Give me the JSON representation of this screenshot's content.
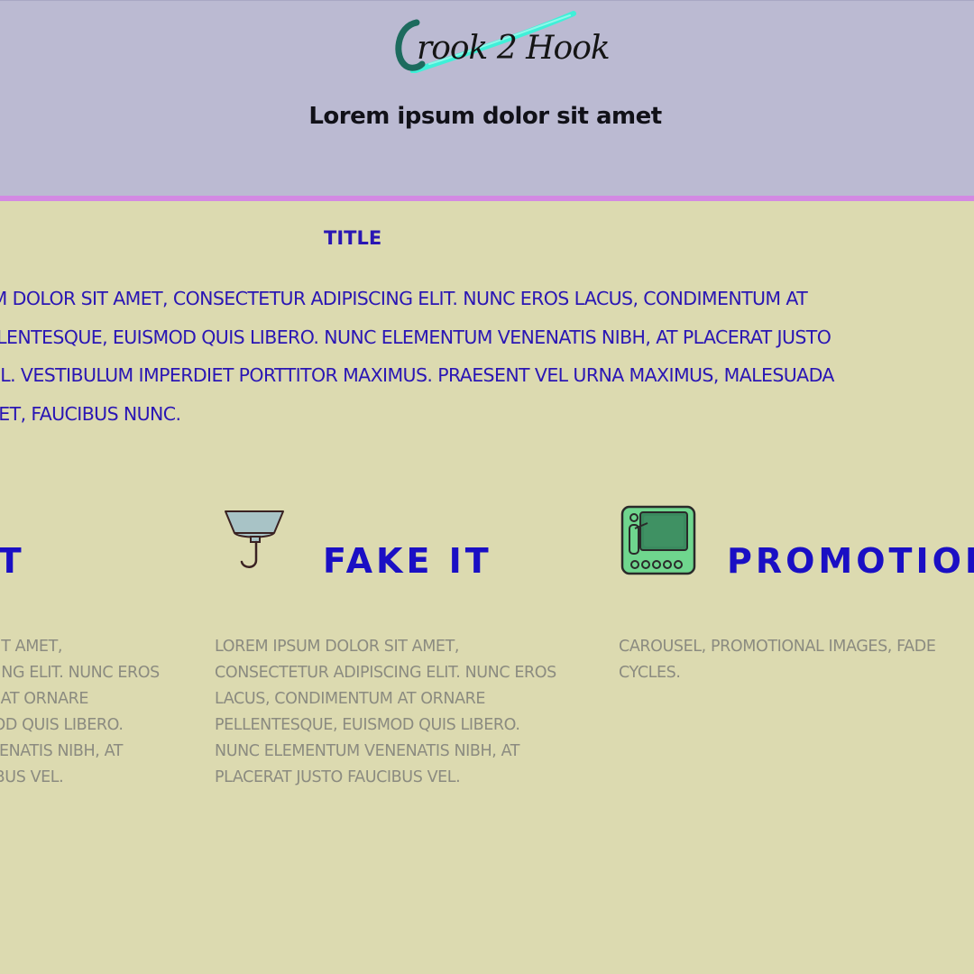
{
  "header": {
    "logo_text": "rook 2 Hook",
    "tagline": "Lorem ipsum dolor sit amet"
  },
  "intro": {
    "title": "TITLE",
    "body": "LOREM IPSUM DOLOR SIT AMET, CONSECTETUR ADIPISCING ELIT. NUNC EROS LACUS, CONDIMENTUM AT ORNARE PELLENTESQUE, EUISMOD QUIS LIBERO. NUNC ELEMENTUM VENENATIS NIBH, AT PLACERAT JUSTO FAUCIBUS VEL. VESTIBULUM IMPERDIET PORTTITOR MAXIMUS. PRAESENT VEL URNA MAXIMUS, MALESUADA ARCU SIT AMET, FAUCIBUS NUNC."
  },
  "features": [
    {
      "title": "FAKE IT",
      "icon": "hook-icon",
      "text": "LOREM IPSUM DOLOR SIT AMET, CONSECTETUR ADIPISCING ELIT. NUNC EROS LACUS, CONDIMENTUM AT ORNARE PELLENTESQUE, EUISMOD QUIS LIBERO. NUNC ELEMENTUM VENENATIS NIBH, AT PLACERAT JUSTO FAUCIBUS VEL."
    },
    {
      "title": "FAKE IT",
      "icon": "hook-icon",
      "text": "LOREM IPSUM DOLOR SIT AMET, CONSECTETUR ADIPISCING ELIT. NUNC EROS LACUS, CONDIMENTUM AT ORNARE PELLENTESQUE, EUISMOD QUIS LIBERO. NUNC ELEMENTUM VENENATIS NIBH, AT PLACERAT JUSTO FAUCIBUS VEL."
    },
    {
      "title": "PROMOTIONS",
      "icon": "presentation-screen-icon",
      "text": "CAROUSEL, PROMOTIONAL IMAGES, FADE CYCLES."
    }
  ],
  "colors": {
    "header_bg": "#bbbad2",
    "header_border": "#d389e3",
    "page_bg": "#dcdab0",
    "title_blue": "#1a0fc4",
    "body_gray": "#8b8b80"
  }
}
